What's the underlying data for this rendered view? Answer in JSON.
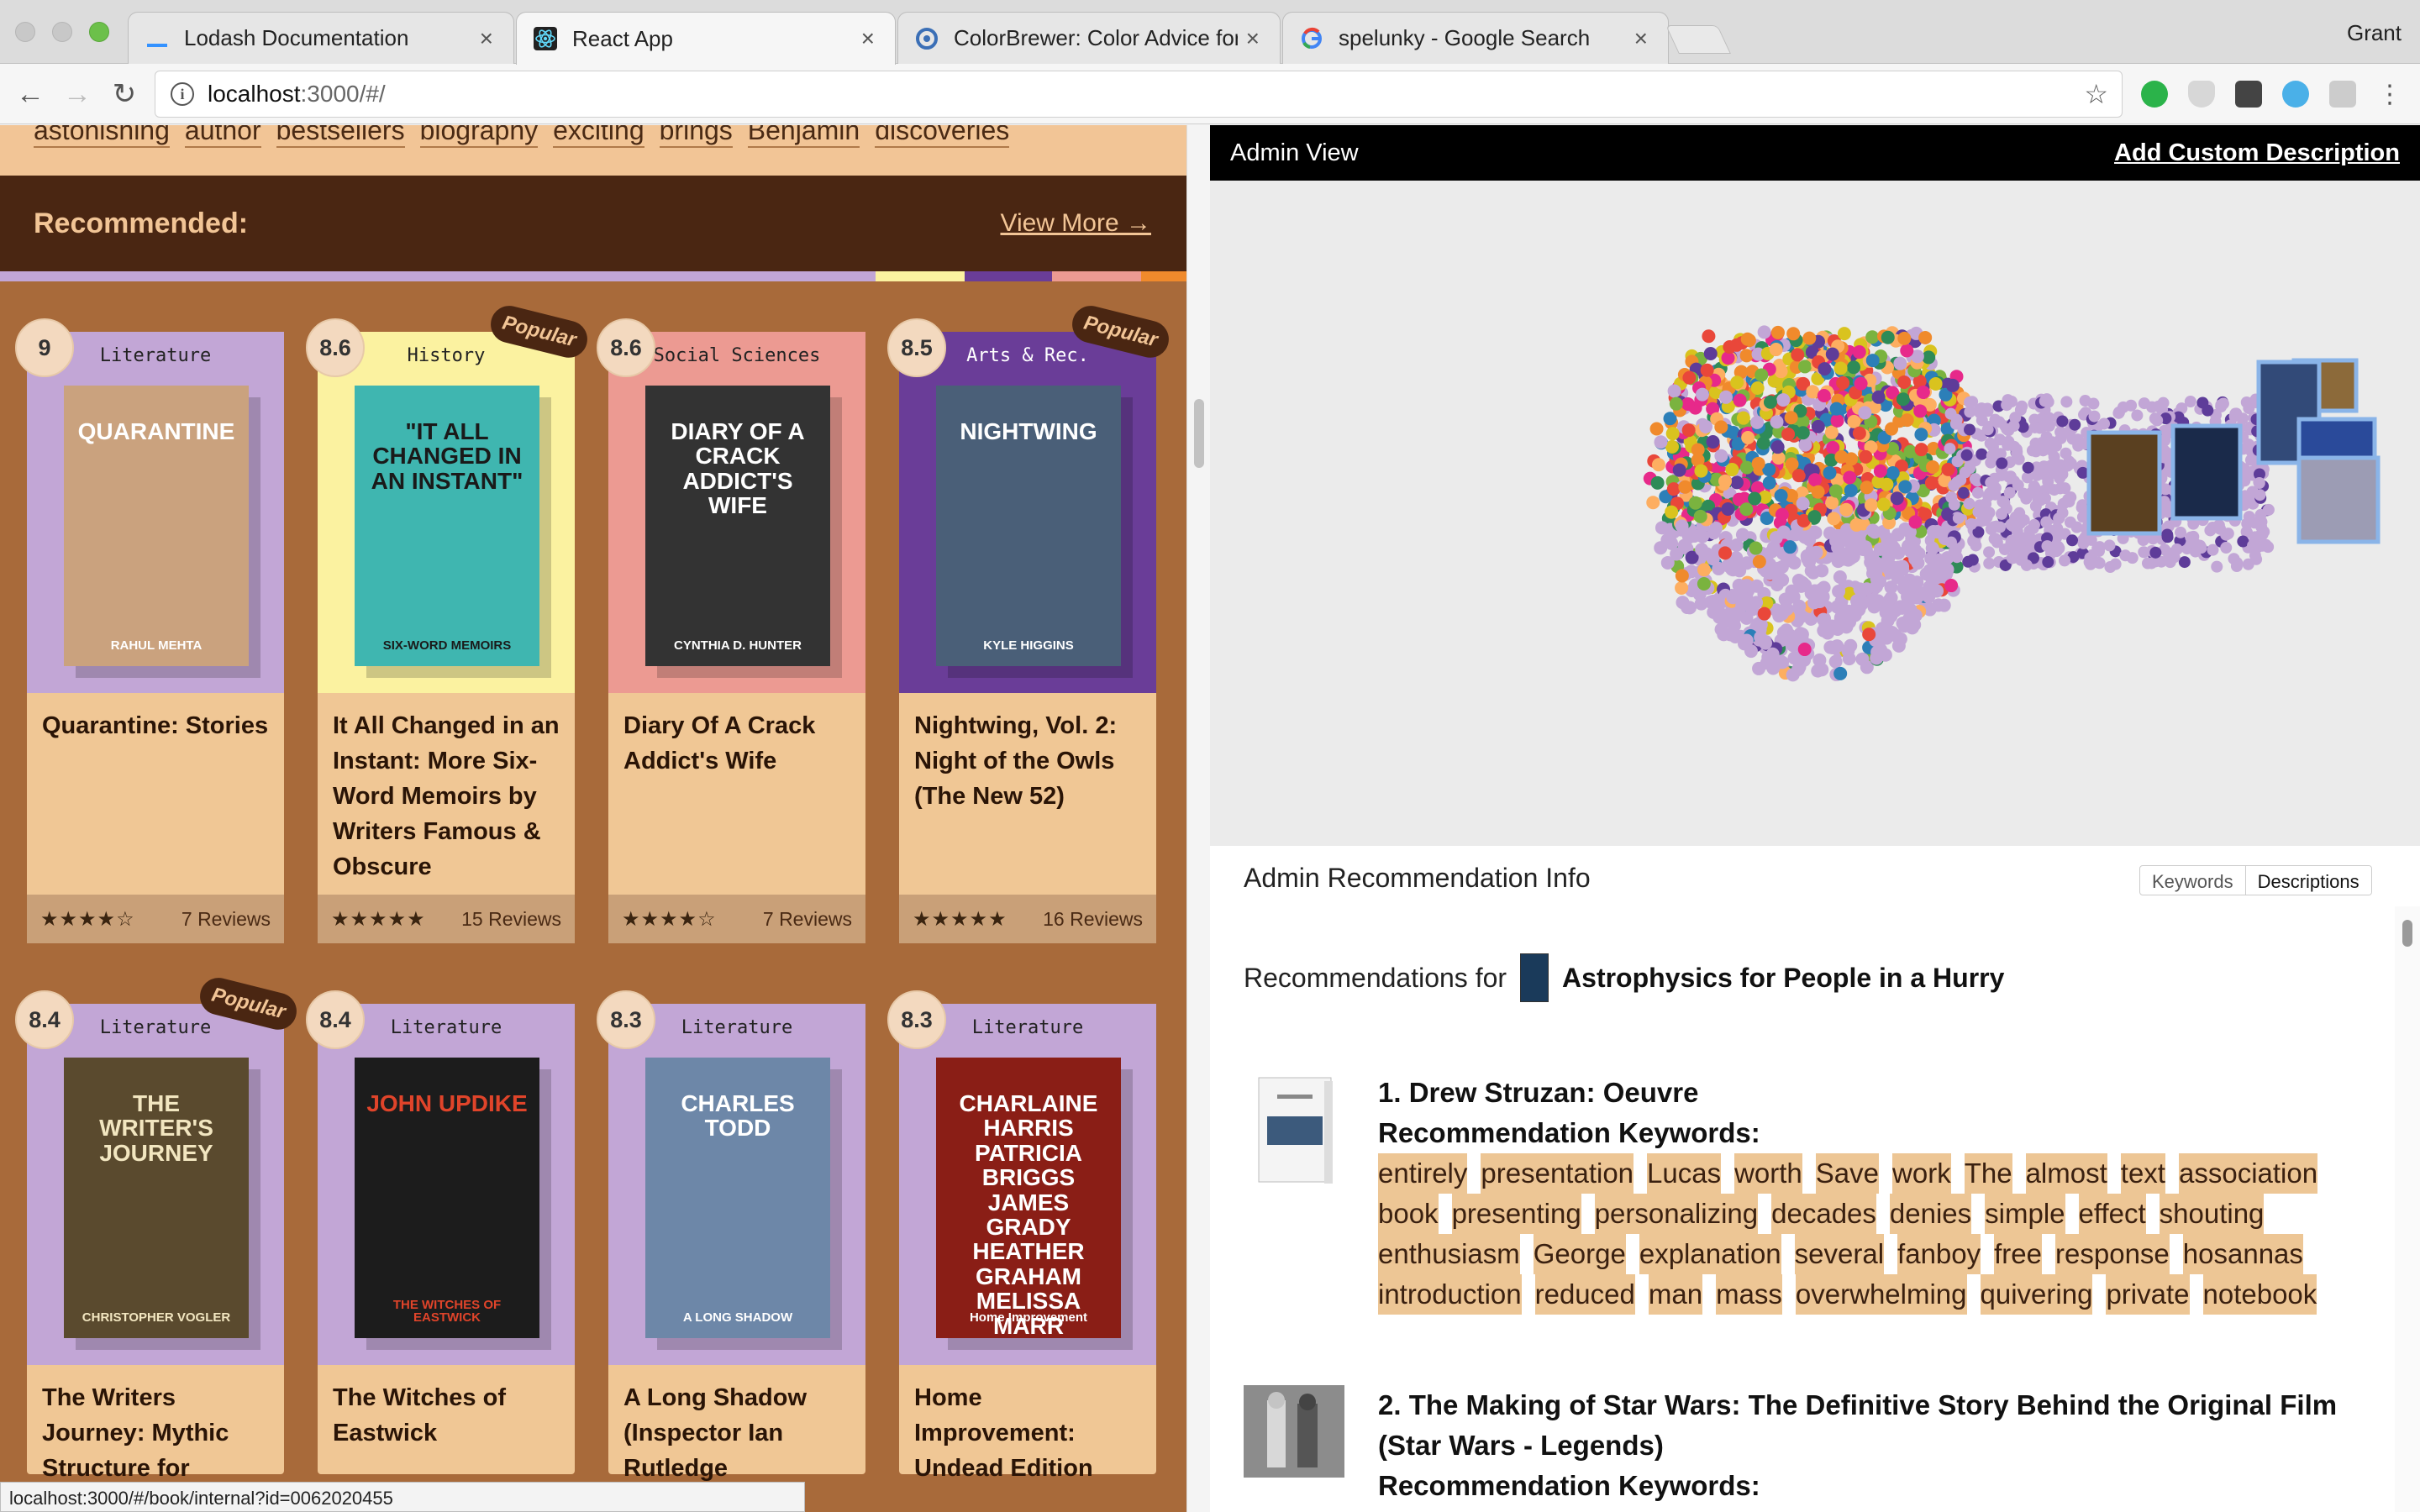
{
  "browser": {
    "profile_name": "Grant",
    "tabs": [
      {
        "title": "Lodash Documentation",
        "icon": "lodash-icon",
        "active": false
      },
      {
        "title": "React App",
        "icon": "react-icon",
        "active": true
      },
      {
        "title": "ColorBrewer: Color Advice for Ma",
        "icon": "colorbrewer-icon",
        "active": false
      },
      {
        "title": "spelunky - Google Search",
        "icon": "google-icon",
        "active": false
      }
    ],
    "url_host": "localhost",
    "url_path": ":3000/#/",
    "status_url": "localhost:3000/#/book/internal?id=0062020455"
  },
  "store": {
    "keywords": [
      "astonishing",
      "author",
      "bestsellers",
      "biography",
      "exciting",
      "brings",
      "Benjamin",
      "discoveries"
    ],
    "recommended_label": "Recommended:",
    "view_more_label": "View More →",
    "popular_label": "Popular",
    "books": [
      {
        "score": "9",
        "genre": "Literature",
        "title": "Quarantine: Stories",
        "stars": "★★★★☆",
        "reviews": "7 Reviews",
        "popular": false,
        "bg": "#c2a6d6",
        "cover_bg": "#caa27e",
        "cover_text": "QUARANTINE",
        "cover_color": "#ffffff",
        "cover_sub": "RAHUL MEHTA"
      },
      {
        "score": "8.6",
        "genre": "History",
        "title": "It All Changed in an Instant: More Six-Word Memoirs by Writers Famous & Obscure",
        "stars": "★★★★★",
        "reviews": "15 Reviews",
        "popular": true,
        "bg": "#fbf2a0",
        "cover_bg": "#3fb6b0",
        "cover_text": "\"IT ALL CHANGED IN AN INSTANT\"",
        "cover_color": "#1a1a1a",
        "cover_sub": "SIX-WORD MEMOIRS"
      },
      {
        "score": "8.6",
        "genre": "Social Sciences",
        "title": "Diary Of A Crack Addict's Wife",
        "stars": "★★★★☆",
        "reviews": "7 Reviews",
        "popular": false,
        "bg": "#ec9a92",
        "cover_bg": "#333333",
        "cover_text": "DIARY OF A CRACK ADDICT'S WIFE",
        "cover_color": "#ffffff",
        "cover_sub": "CYNTHIA D. HUNTER"
      },
      {
        "score": "8.5",
        "genre": "Arts & Rec.",
        "title": "Nightwing, Vol. 2: Night of the Owls (The New 52)",
        "stars": "★★★★★",
        "reviews": "16 Reviews",
        "popular": true,
        "bg": "#6a3d98",
        "cover_bg": "#4a5f78",
        "cover_text": "NIGHTWING",
        "cover_color": "#ffffff",
        "cover_sub": "KYLE HIGGINS"
      },
      {
        "score": "8.4",
        "genre": "Literature",
        "title": "The Writers Journey: Mythic Structure for",
        "stars": "",
        "reviews": "",
        "popular": true,
        "bg": "#c2a6d6",
        "cover_bg": "#5a4a2e",
        "cover_text": "THE WRITER'S JOURNEY",
        "cover_color": "#f2e6c0",
        "cover_sub": "CHRISTOPHER VOGLER"
      },
      {
        "score": "8.4",
        "genre": "Literature",
        "title": "The Witches of Eastwick",
        "stars": "",
        "reviews": "",
        "popular": false,
        "bg": "#c2a6d6",
        "cover_bg": "#1c1c1c",
        "cover_text": "JOHN UPDIKE",
        "cover_color": "#e0442a",
        "cover_sub": "THE WITCHES OF EASTWICK"
      },
      {
        "score": "8.3",
        "genre": "Literature",
        "title": "A Long Shadow (Inspector Ian Rutledge",
        "stars": "",
        "reviews": "",
        "popular": false,
        "bg": "#c2a6d6",
        "cover_bg": "#6d87a8",
        "cover_text": "CHARLES TODD",
        "cover_color": "#ffffff",
        "cover_sub": "A LONG SHADOW"
      },
      {
        "score": "8.3",
        "genre": "Literature",
        "title": "Home Improvement: Undead Edition",
        "stars": "",
        "reviews": "",
        "popular": false,
        "bg": "#c2a6d6",
        "cover_bg": "#8a1e16",
        "cover_text": "CHARLAINE HARRIS PATRICIA BRIGGS JAMES GRADY HEATHER GRAHAM MELISSA MARR",
        "cover_color": "#ffffff",
        "cover_sub": "Home Improvement"
      }
    ]
  },
  "admin": {
    "title": "Admin View",
    "add_description_label": "Add Custom Description",
    "info_title": "Admin Recommendation Info",
    "tab_keywords": "Keywords",
    "tab_descriptions": "Descriptions",
    "recs_for_label": "Recommendations for",
    "recs_for_book": "Astrophysics for People in a Hurry",
    "recommendations": [
      {
        "title": "1. Drew Struzan: Oeuvre",
        "keywords_label": "Recommendation Keywords:",
        "keywords": [
          "entirely",
          "presentation",
          "Lucas",
          "worth",
          "Save",
          "work",
          "The",
          "almost",
          "text",
          "association",
          "book",
          "presenting",
          "personalizing",
          "decades",
          "denies",
          "simple",
          "effect",
          "shouting",
          "enthusiasm",
          "George",
          "explanation",
          "several",
          "fanboy",
          "free",
          "response",
          "hosannas",
          "introduction",
          "reduced",
          "man",
          "mass",
          "overwhelming",
          "quivering",
          "private",
          "notebook"
        ]
      },
      {
        "title": "2. The Making of Star Wars: The Definitive Story Behind the Original Film (Star Wars - Legends)",
        "keywords_label": "Recommendation Keywords:",
        "keywords": []
      }
    ],
    "scatter_colors": [
      "#7ab33f",
      "#f08a2c",
      "#e7298a",
      "#d9c31e",
      "#5e3c99",
      "#2c7fb8",
      "#e9473a",
      "#c2a6d6",
      "#fdae61",
      "#2e8b57"
    ]
  }
}
